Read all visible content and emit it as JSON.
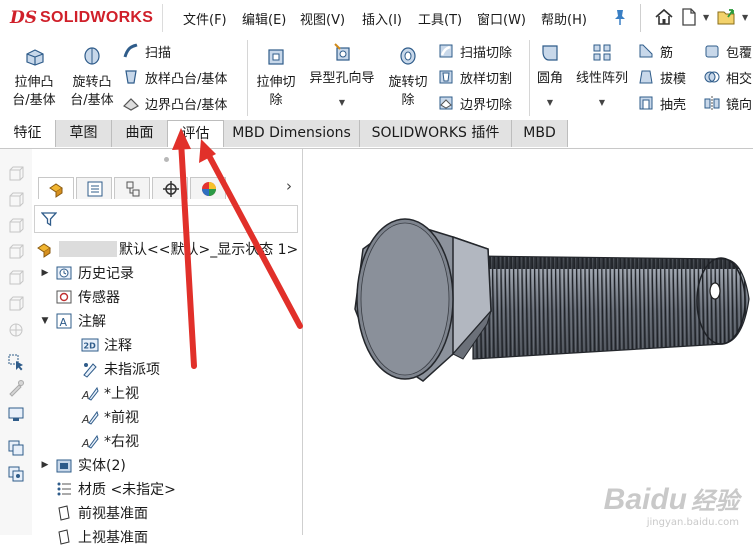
{
  "app": {
    "logo_prefix": "DS",
    "logo_name": "SOLIDWORKS",
    "brand_color": "#d0202a"
  },
  "menu": [
    "文件(F)",
    "编辑(E)",
    "视图(V)",
    "插入(I)",
    "工具(T)",
    "窗口(W)",
    "帮助(H)"
  ],
  "quick_access": {
    "icons": [
      "pin-icon",
      "home-icon",
      "new-document-icon",
      "open-icon"
    ]
  },
  "ribbon": {
    "extrude_boss": "拉伸凸台/基体",
    "revolve_boss": "旋转凸台/基体",
    "sweep": "扫描",
    "loft_boss": "放样凸台/基体",
    "boundary_boss": "边界凸台/基体",
    "extrude_cut": "拉伸切除",
    "hole_wizard": "异型孔向导",
    "revolve_cut": "旋转切除",
    "swept_cut": "扫描切除",
    "lofted_cut": "放样切割",
    "boundary_cut": "边界切除",
    "fillet": "圆角",
    "linear_pattern": "线性阵列",
    "rib": "筋",
    "draft": "拔模",
    "shell": "抽壳",
    "wrap": "包覆",
    "intersect": "相交",
    "mirror": "镜向"
  },
  "tabs": [
    "特征",
    "草图",
    "曲面",
    "评估",
    "MBD Dimensions",
    "SOLIDWORKS 插件",
    "MBD"
  ],
  "selected_tab": "评估",
  "feature_tree": {
    "root_label": "默认<<默认>_显示状态 1>",
    "items": [
      {
        "label": "历史记录",
        "icon": "history-icon",
        "expander": "▶",
        "level": 0
      },
      {
        "label": "传感器",
        "icon": "sensor-icon",
        "expander": "",
        "level": 0
      },
      {
        "label": "注解",
        "icon": "annotation-icon",
        "expander": "▼",
        "level": 0
      },
      {
        "label": "注释",
        "icon": "note-2d-icon",
        "expander": "",
        "level": 1
      },
      {
        "label": "未指派项",
        "icon": "unassigned-icon",
        "expander": "",
        "level": 1
      },
      {
        "label": "*上视",
        "icon": "view-annotation-icon",
        "expander": "",
        "level": 1
      },
      {
        "label": "*前视",
        "icon": "view-annotation-icon",
        "expander": "",
        "level": 1
      },
      {
        "label": "*右视",
        "icon": "view-annotation-icon",
        "expander": "",
        "level": 1
      },
      {
        "label": "实体(2)",
        "icon": "solid-bodies-icon",
        "expander": "▶",
        "level": 0
      },
      {
        "label": "材质 <未指定>",
        "icon": "material-icon",
        "expander": "",
        "level": 0
      },
      {
        "label": "前视基准面",
        "icon": "plane-icon",
        "expander": "",
        "level": 0
      },
      {
        "label": "上视基准面",
        "icon": "plane-icon",
        "expander": "",
        "level": 0
      }
    ]
  },
  "watermark": {
    "brand": "Baidu",
    "brand_cn": "经验",
    "url": "jingyan.baidu.com"
  }
}
